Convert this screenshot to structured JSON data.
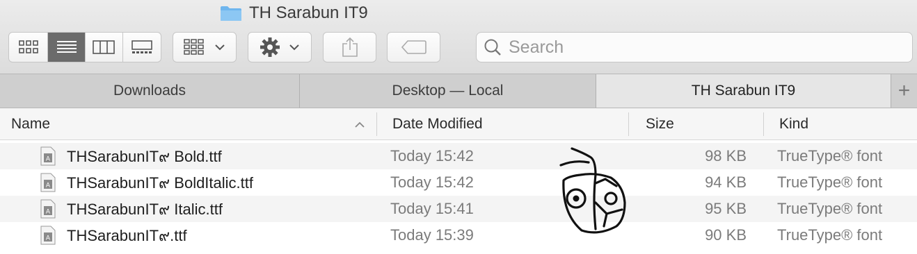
{
  "window": {
    "title": "TH Sarabun IT9"
  },
  "toolbar": {
    "view_modes": [
      "icon-view",
      "list-view",
      "column-view",
      "gallery-view"
    ],
    "active_view": "list-view",
    "group_icon": "group-by-icon",
    "action_icon": "gear-icon",
    "share_icon": "share-icon",
    "tag_icon": "tag-icon"
  },
  "search": {
    "placeholder": "Search",
    "value": ""
  },
  "tabs": [
    {
      "label": "Downloads",
      "active": false
    },
    {
      "label": "Desktop — Local",
      "active": false
    },
    {
      "label": "TH Sarabun IT9",
      "active": true
    }
  ],
  "tab_add_label": "+",
  "columns": {
    "name": "Name",
    "date": "Date Modified",
    "size": "Size",
    "kind": "Kind"
  },
  "files": [
    {
      "name": "THSarabunIT๙ Bold.ttf",
      "date": "Today 15:42",
      "size": "98 KB",
      "kind": "TrueType® font"
    },
    {
      "name": "THSarabunIT๙ BoldItalic.ttf",
      "date": "Today 15:42",
      "size": "94 KB",
      "kind": "TrueType® font"
    },
    {
      "name": "THSarabunIT๙ Italic.ttf",
      "date": "Today 15:41",
      "size": "95 KB",
      "kind": "TrueType® font"
    },
    {
      "name": "THSarabunIT๙.ttf",
      "date": "Today 15:39",
      "size": "90 KB",
      "kind": "TrueType® font"
    }
  ],
  "colors": {
    "folder": "#6fb6ee",
    "active_segment": "#6b6b6b",
    "tabbar": "#cfcfcf"
  }
}
